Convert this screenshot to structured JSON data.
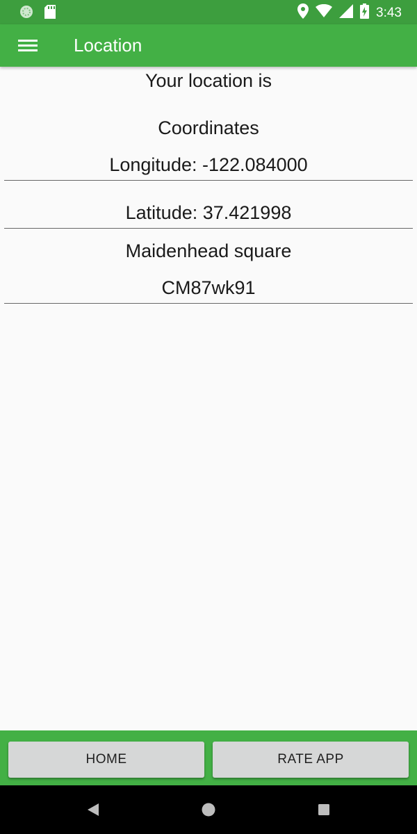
{
  "status_bar": {
    "time": "3:43",
    "icons": [
      "sync-icon",
      "sd-card-icon",
      "location-pin-icon",
      "wifi-icon",
      "signal-icon",
      "battery-charging-icon"
    ]
  },
  "app_bar": {
    "title": "Location",
    "menu_icon": "hamburger-menu-icon",
    "color": "#43b045"
  },
  "content": {
    "heading": "Your location is",
    "coordinates_label": "Coordinates",
    "longitude": "Longitude: -122.084000",
    "latitude": "Latitude: 37.421998",
    "maidenhead_label": "Maidenhead square",
    "maidenhead_value": "CM87wk91"
  },
  "buttons": {
    "home": "HOME",
    "rate_app": "RATE APP"
  },
  "nav_bar": {
    "back": "back-triangle-icon",
    "home": "home-circle-icon",
    "recents": "recents-square-icon"
  }
}
